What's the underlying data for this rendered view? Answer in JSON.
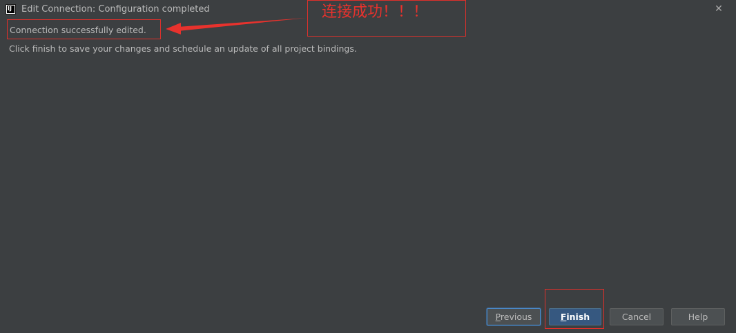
{
  "window": {
    "title": "Edit Connection: Configuration completed",
    "app_icon_label": "IJ"
  },
  "content": {
    "success_message": "Connection successfully edited.",
    "info_message": "Click finish to save your changes and schedule an update of all project bindings."
  },
  "annotation": {
    "text": "连接成功！！！",
    "color": "#e8322d"
  },
  "buttons": {
    "previous": {
      "mnemonic": "P",
      "rest": "revious"
    },
    "finish": {
      "mnemonic": "F",
      "rest": "inish"
    },
    "cancel": "Cancel",
    "help": "Help"
  },
  "colors": {
    "background": "#3c3f41",
    "text": "#bbbbbb",
    "annotation_red": "#e0302b",
    "primary_button": "#365880"
  }
}
